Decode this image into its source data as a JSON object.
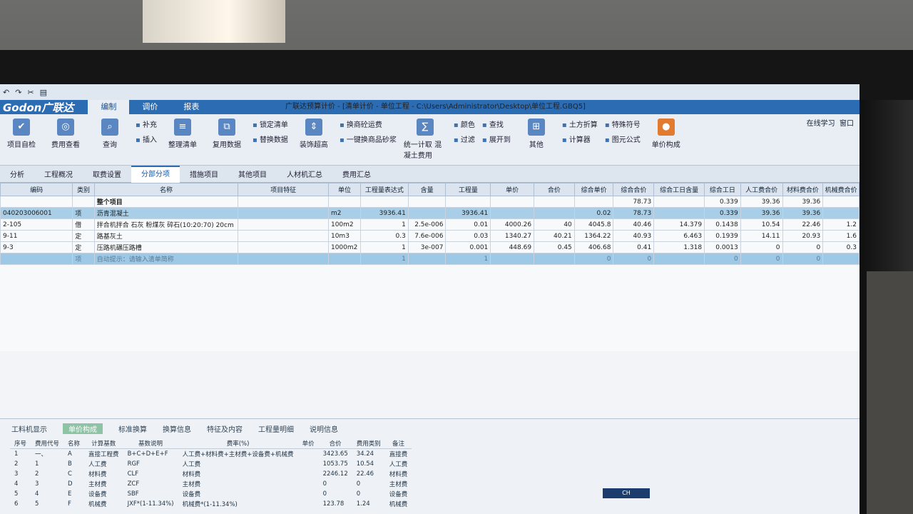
{
  "window": {
    "title": "广联达预算计价 - [清单计价 - 单位工程 - C:\\Users\\Administrator\\Desktop\\单位工程.GBQ5]",
    "logo": "Godon广联达"
  },
  "ribbon_tabs": [
    {
      "label": "编制",
      "active": true
    },
    {
      "label": "调价",
      "active": false
    },
    {
      "label": "报表",
      "active": false
    }
  ],
  "ribbon": {
    "items": [
      "项目自检",
      "费用查看",
      "查询",
      "补充",
      "插入",
      "整理清单",
      "复用数据",
      "锁定清单",
      "替换数据",
      "装饰超高",
      "换商砼运费",
      "一键换商品砂浆",
      "统一计取 混凝土费用",
      "颜色",
      "查找",
      "过滤",
      "展开到",
      "其他",
      "土方折算",
      "特殊符号",
      "计算器",
      "图元公式",
      "单价构成"
    ],
    "online": "在线学习",
    "window_menu": "窗口"
  },
  "nav_tabs": [
    {
      "label": "分析",
      "active": false
    },
    {
      "label": "工程概况",
      "active": false
    },
    {
      "label": "取费设置",
      "active": false
    },
    {
      "label": "分部分项",
      "active": true
    },
    {
      "label": "措施项目",
      "active": false
    },
    {
      "label": "其他项目",
      "active": false
    },
    {
      "label": "人材机汇总",
      "active": false
    },
    {
      "label": "费用汇总",
      "active": false
    }
  ],
  "grid": {
    "headers": [
      "编码",
      "类别",
      "名称",
      "项目特征",
      "单位",
      "工程量表达式",
      "含量",
      "工程量",
      "单价",
      "合价",
      "综合单价",
      "综合合价",
      "综合工日含量",
      "综合工日",
      "人工费合价",
      "材料费合价",
      "机械费合价"
    ],
    "rows": [
      [
        "",
        "",
        "整个项目",
        "",
        "",
        "",
        "",
        "",
        "",
        "",
        "",
        "78.73",
        "",
        "0.339",
        "39.36",
        "39.36",
        ""
      ],
      [
        "040203006001",
        "项",
        "沥青混凝土",
        "",
        "m2",
        "3936.41",
        "",
        "3936.41",
        "",
        "",
        "0.02",
        "78.73",
        "",
        "0.339",
        "39.36",
        "39.36",
        ""
      ],
      [
        "2-105",
        "借",
        "拌合机拌合 石灰 粉煤灰 碎石(10:20:70) 20cm",
        "",
        "100m2",
        "1",
        "2.5e-006",
        "0.01",
        "4000.26",
        "40",
        "4045.8",
        "40.46",
        "14.379",
        "0.1438",
        "10.54",
        "22.46",
        "1.2"
      ],
      [
        "9-11",
        "定",
        "路基灰土",
        "",
        "10m3",
        "0.3",
        "7.6e-006",
        "0.03",
        "1340.27",
        "40.21",
        "1364.22",
        "40.93",
        "6.463",
        "0.1939",
        "14.11",
        "20.93",
        "1.6"
      ],
      [
        "9-3",
        "定",
        "压路机碾压路槽",
        "",
        "1000m2",
        "1",
        "3e-007",
        "0.001",
        "448.69",
        "0.45",
        "406.68",
        "0.41",
        "1.318",
        "0.0013",
        "0",
        "0",
        "0.3"
      ],
      [
        "",
        "项",
        "自动提示：请输入清单简称",
        "",
        "",
        "1",
        "",
        "1",
        "",
        "",
        "0",
        "0",
        "",
        "0",
        "0",
        "0",
        ""
      ]
    ]
  },
  "bottom_tabs": [
    {
      "label": "工料机显示",
      "active": false
    },
    {
      "label": "单价构成",
      "active": true
    },
    {
      "label": "标准换算",
      "active": false
    },
    {
      "label": "换算信息",
      "active": false
    },
    {
      "label": "特征及内容",
      "active": false
    },
    {
      "label": "工程量明细",
      "active": false
    },
    {
      "label": "说明信息",
      "active": false
    }
  ],
  "fee_table": {
    "headers": [
      "序号",
      "费用代号",
      "名称",
      "计算基数",
      "基数说明",
      "费率(%)",
      "单价",
      "合价",
      "费用类别",
      "备注"
    ],
    "rows": [
      [
        "1",
        "一、",
        "A",
        "直接工程费",
        "B+C+D+E+F",
        "人工费+材料费+主材费+设备费+机械费",
        "",
        "3423.65",
        "34.24",
        "直接费"
      ],
      [
        "2",
        "1",
        "B",
        "人工费",
        "RGF",
        "人工费",
        "",
        "1053.75",
        "10.54",
        "人工费"
      ],
      [
        "3",
        "2",
        "C",
        "材料费",
        "CLF",
        "材料费",
        "",
        "2246.12",
        "22.46",
        "材料费"
      ],
      [
        "4",
        "3",
        "D",
        "主材费",
        "ZCF",
        "主材费",
        "",
        "0",
        "0",
        "主材费"
      ],
      [
        "5",
        "4",
        "E",
        "设备费",
        "SBF",
        "设备费",
        "",
        "0",
        "0",
        "设备费"
      ],
      [
        "6",
        "5",
        "F",
        "机械费",
        "JXF*(1-11.34%)",
        "机械费*(1-11.34%)",
        "",
        "123.78",
        "1.24",
        "机械费"
      ]
    ]
  },
  "ime": "CH"
}
